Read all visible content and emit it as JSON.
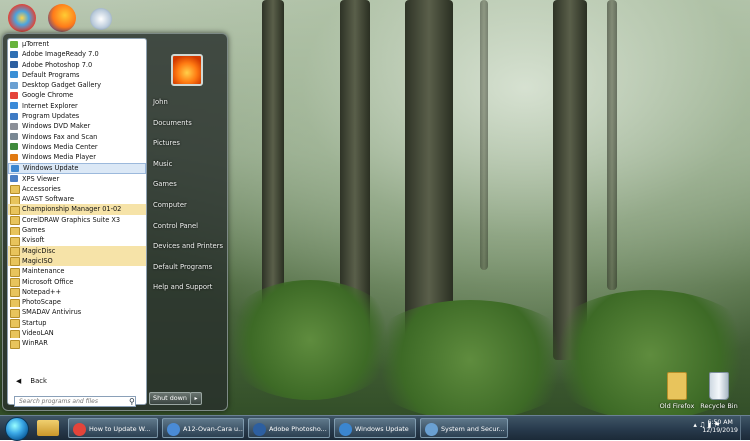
{
  "start_menu": {
    "programs": [
      {
        "label": "µTorrent",
        "icon": "utorrent-icon",
        "color": "#68b33c"
      },
      {
        "label": "Adobe ImageReady 7.0",
        "icon": "imageready-icon",
        "color": "#2f6fb3"
      },
      {
        "label": "Adobe Photoshop 7.0",
        "icon": "photoshop-icon",
        "color": "#2d5fa0"
      },
      {
        "label": "Default Programs",
        "icon": "default-programs-icon",
        "color": "#3a8fd6"
      },
      {
        "label": "Desktop Gadget Gallery",
        "icon": "gadget-icon",
        "color": "#6aa0d2"
      },
      {
        "label": "Google Chrome",
        "icon": "chrome-icon",
        "color": "#e4443a"
      },
      {
        "label": "Internet Explorer",
        "icon": "ie-icon",
        "color": "#3a8ad8"
      },
      {
        "label": "Program Updates",
        "icon": "program-updates-icon",
        "color": "#3e7bc4"
      },
      {
        "label": "Windows DVD Maker",
        "icon": "dvd-maker-icon",
        "color": "#8b8f98"
      },
      {
        "label": "Windows Fax and Scan",
        "icon": "fax-scan-icon",
        "color": "#7a8894"
      },
      {
        "label": "Windows Media Center",
        "icon": "media-center-icon",
        "color": "#3f8a3c"
      },
      {
        "label": "Windows Media Player",
        "icon": "media-player-icon",
        "color": "#e17a12"
      },
      {
        "label": "Windows Update",
        "icon": "windows-update-icon",
        "color": "#3b86d0",
        "selected": true
      },
      {
        "label": "XPS Viewer",
        "icon": "xps-viewer-icon",
        "color": "#4b7fc4"
      },
      {
        "label": "Accessories",
        "icon": "folder-icon",
        "folder": true
      },
      {
        "label": "AVAST Software",
        "icon": "folder-icon",
        "folder": true
      },
      {
        "label": "Championship Manager 01-02",
        "icon": "folder-icon",
        "folder": true,
        "highlight": true
      },
      {
        "label": "CorelDRAW Graphics Suite X3",
        "icon": "folder-icon",
        "folder": true
      },
      {
        "label": "Games",
        "icon": "folder-icon",
        "folder": true
      },
      {
        "label": "Kvisoft",
        "icon": "folder-icon",
        "folder": true
      },
      {
        "label": "MagicDisc",
        "icon": "folder-icon",
        "folder": true,
        "highlight": true
      },
      {
        "label": "MagicISO",
        "icon": "folder-icon",
        "folder": true,
        "highlight": true
      },
      {
        "label": "Maintenance",
        "icon": "folder-icon",
        "folder": true
      },
      {
        "label": "Microsoft Office",
        "icon": "folder-icon",
        "folder": true
      },
      {
        "label": "Notepad++",
        "icon": "folder-icon",
        "folder": true
      },
      {
        "label": "PhotoScape",
        "icon": "folder-icon",
        "folder": true
      },
      {
        "label": "SMADAV Antivirus",
        "icon": "folder-icon",
        "folder": true
      },
      {
        "label": "Startup",
        "icon": "folder-icon",
        "folder": true
      },
      {
        "label": "VideoLAN",
        "icon": "folder-icon",
        "folder": true
      },
      {
        "label": "WinRAR",
        "icon": "folder-icon",
        "folder": true
      }
    ],
    "back_label": "Back",
    "back_arrow": "◀",
    "search_placeholder": "Search programs and files",
    "search_glyph": "⚲",
    "right_links": [
      "John",
      "Documents",
      "Pictures",
      "Music",
      "Games",
      "Computer",
      "Control Panel",
      "Devices and Printers",
      "Default Programs",
      "Help and Support"
    ],
    "shutdown_label": "Shut down",
    "shutdown_arrow": "▸"
  },
  "desktop_icons": [
    {
      "label": "Old Firefox",
      "icon": "folder-icon"
    },
    {
      "label": "Recycle Bin",
      "icon": "recycle-bin-icon"
    }
  ],
  "taskbar": {
    "windows": [
      {
        "label": "How to Update W...",
        "icon": "chrome-icon",
        "color": "#e4443a"
      },
      {
        "label": "A12-Ovan-Cara u...",
        "icon": "document-icon",
        "color": "#4a8bd6"
      },
      {
        "label": "Adobe Photosho...",
        "icon": "photoshop-icon",
        "color": "#2d5fa0"
      },
      {
        "label": "Windows Update",
        "icon": "windows-update-icon",
        "color": "#3b86d0"
      },
      {
        "label": "System and Secur...",
        "icon": "control-panel-icon",
        "color": "#6aa0d2"
      }
    ],
    "tray_glyphs": "▴ ♫ ▮ ⚑",
    "time": "6:50 AM",
    "date": "12/19/2019"
  }
}
